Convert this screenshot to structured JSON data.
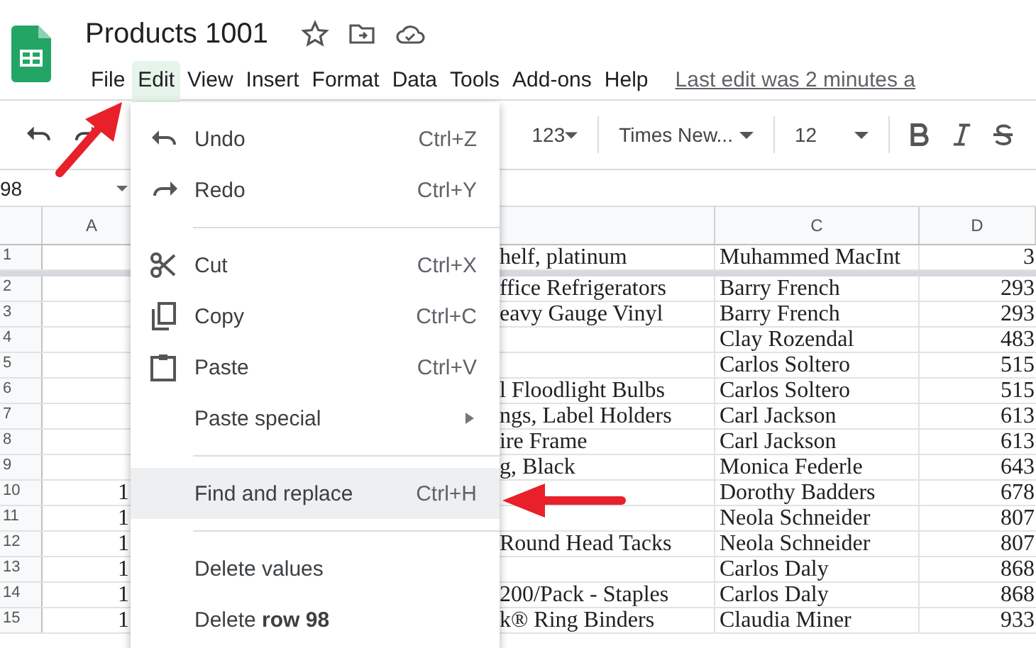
{
  "document": {
    "title": "Products 1001"
  },
  "menubar": [
    {
      "label": "File",
      "selected": false
    },
    {
      "label": "Edit",
      "selected": true
    },
    {
      "label": "View",
      "selected": false
    },
    {
      "label": "Insert",
      "selected": false
    },
    {
      "label": "Format",
      "selected": false
    },
    {
      "label": "Data",
      "selected": false
    },
    {
      "label": "Tools",
      "selected": false
    },
    {
      "label": "Add-ons",
      "selected": false
    },
    {
      "label": "Help",
      "selected": false
    }
  ],
  "last_edit": "Last edit was 2 minutes a",
  "toolbar": {
    "number_format": "123",
    "font": "Times New...",
    "font_size": "12"
  },
  "name_box": "98",
  "column_headers": {
    "a": "A",
    "c": "C",
    "d": "D"
  },
  "rows": [
    {
      "number": "1",
      "b": "helf, platinum",
      "c": "Muhammed MacInt",
      "d": "3"
    },
    {
      "number": "2",
      "b": "ffice Refrigerators",
      "c": "Barry French",
      "d": "293"
    },
    {
      "number": "3",
      "b": "eavy Gauge Vinyl",
      "c": "Barry French",
      "d": "293"
    },
    {
      "number": "4",
      "c": "Clay Rozendal",
      "d": "483"
    },
    {
      "number": "5",
      "c": "Carlos Soltero",
      "d": "515"
    },
    {
      "number": "6",
      "b": "l Floodlight Bulbs",
      "c": "Carlos Soltero",
      "d": "515"
    },
    {
      "number": "7",
      "b": "ngs, Label Holders",
      "c": "Carl Jackson",
      "d": "613"
    },
    {
      "number": "8",
      "b": "ire Frame",
      "c": "Carl Jackson",
      "d": "613"
    },
    {
      "number": "9",
      "b": "g, Black",
      "c": "Monica Federle",
      "d": "643"
    },
    {
      "number": "10",
      "a": "1",
      "c": "Dorothy Badders",
      "d": "678"
    },
    {
      "number": "11",
      "a": "1",
      "c": "Neola Schneider",
      "d": "807"
    },
    {
      "number": "12",
      "a": "1",
      "b": "Round Head Tacks",
      "c": "Neola Schneider",
      "d": "807"
    },
    {
      "number": "13",
      "a": "1",
      "c": "Carlos Daly",
      "d": "868"
    },
    {
      "number": "14",
      "a": "1",
      "b": "200/Pack - Staples",
      "c": "Carlos Daly",
      "d": "868"
    },
    {
      "number": "15",
      "a": "1",
      "b": "k® Ring Binders",
      "c": "Claudia Miner",
      "d": "933"
    }
  ],
  "edit_menu": {
    "groups": [
      [
        {
          "label": "Undo",
          "shortcut": "Ctrl+Z",
          "selected": false
        },
        {
          "label": "Redo",
          "shortcut": "Ctrl+Y",
          "selected": false
        }
      ],
      [
        {
          "label": "Cut",
          "shortcut": "Ctrl+X",
          "selected": false
        },
        {
          "label": "Copy",
          "shortcut": "Ctrl+C",
          "selected": false
        },
        {
          "label": "Paste",
          "shortcut": "Ctrl+V",
          "selected": false
        },
        {
          "label": "Paste special",
          "submenu": true,
          "selected": false
        }
      ],
      [
        {
          "label": "Find and replace",
          "shortcut": "Ctrl+H",
          "selected": true
        }
      ],
      [
        {
          "label": "Delete values",
          "selected": false
        },
        {
          "label": "Delete **row 98**",
          "selected": false
        }
      ]
    ]
  }
}
